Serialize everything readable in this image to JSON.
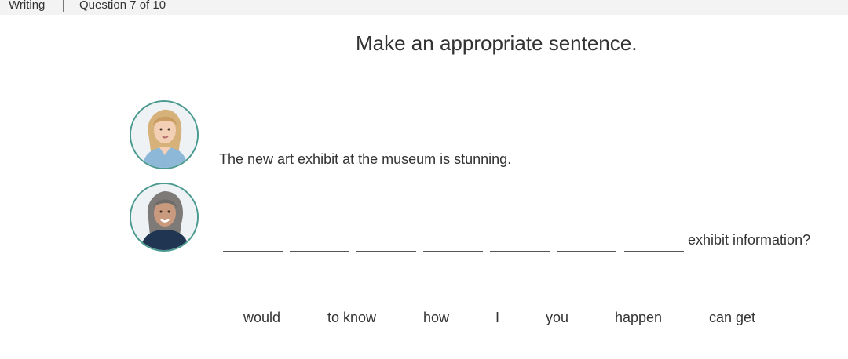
{
  "header": {
    "section": "Writing",
    "progress": "Question 7 of 10"
  },
  "instruction": "Make an appropriate sentence.",
  "dialogue": {
    "line1": "The new art exhibit at the museum is stunning.",
    "line2_tail": "exhibit information?",
    "blank_count": 7
  },
  "word_bank": [
    "would",
    "to know",
    "how",
    "I",
    "you",
    "happen",
    "can get"
  ],
  "colors": {
    "avatar_border": "#4a9a8f",
    "topbar_bg": "#f3f3f3",
    "text": "#333333"
  }
}
